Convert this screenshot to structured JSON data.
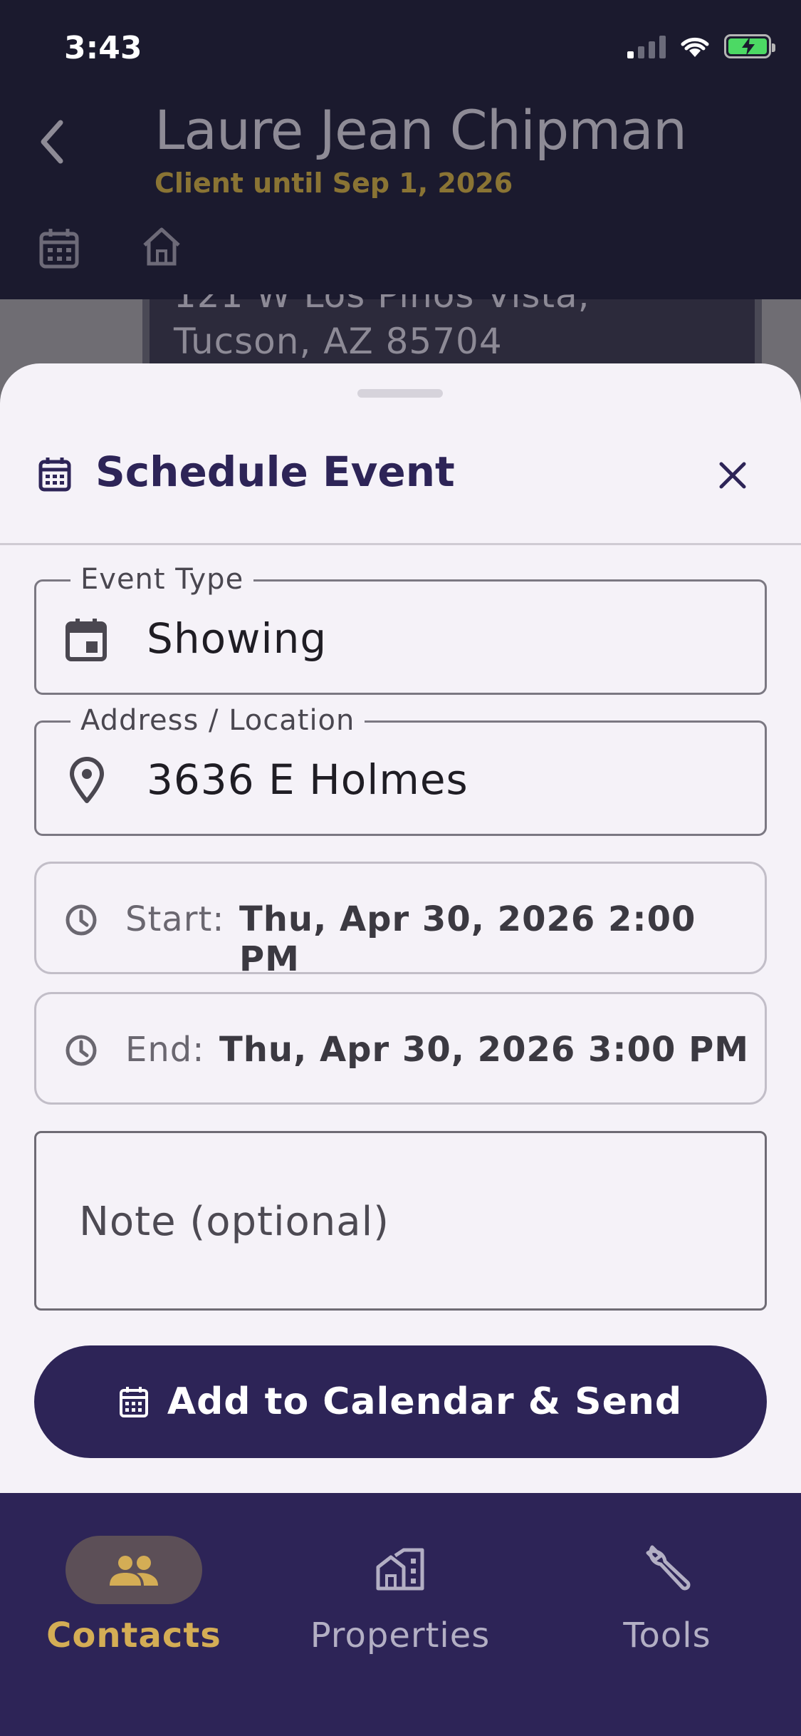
{
  "status_bar": {
    "time": "3:43"
  },
  "background": {
    "client_name": "Laure Jean Chipman",
    "client_until": "Client until Sep 1, 2026",
    "address_line1": "121 W Los Pinos Vista,",
    "address_line2": "Tucson, AZ 85704"
  },
  "sheet": {
    "title": "Schedule Event",
    "event_type": {
      "label": "Event Type",
      "value": "Showing"
    },
    "location": {
      "label": "Address / Location",
      "value": "3636 E Holmes"
    },
    "start": {
      "label": "Start:",
      "value": "Thu, Apr 30, 2026 2:00 PM"
    },
    "end": {
      "label": "End:",
      "value": "Thu, Apr 30, 2026 3:00 PM"
    },
    "note": {
      "placeholder": "Note (optional)"
    },
    "submit_label": "Add to Calendar & Send"
  },
  "nav": {
    "items": [
      {
        "label": "Contacts",
        "icon": "people-icon",
        "active": true
      },
      {
        "label": "Properties",
        "icon": "buildings-icon",
        "active": false
      },
      {
        "label": "Tools",
        "icon": "wrench-icon",
        "active": false
      }
    ]
  },
  "colors": {
    "primary": "#2d2457",
    "accent": "#d4ad55",
    "sheet_bg": "#f5f2f8"
  }
}
